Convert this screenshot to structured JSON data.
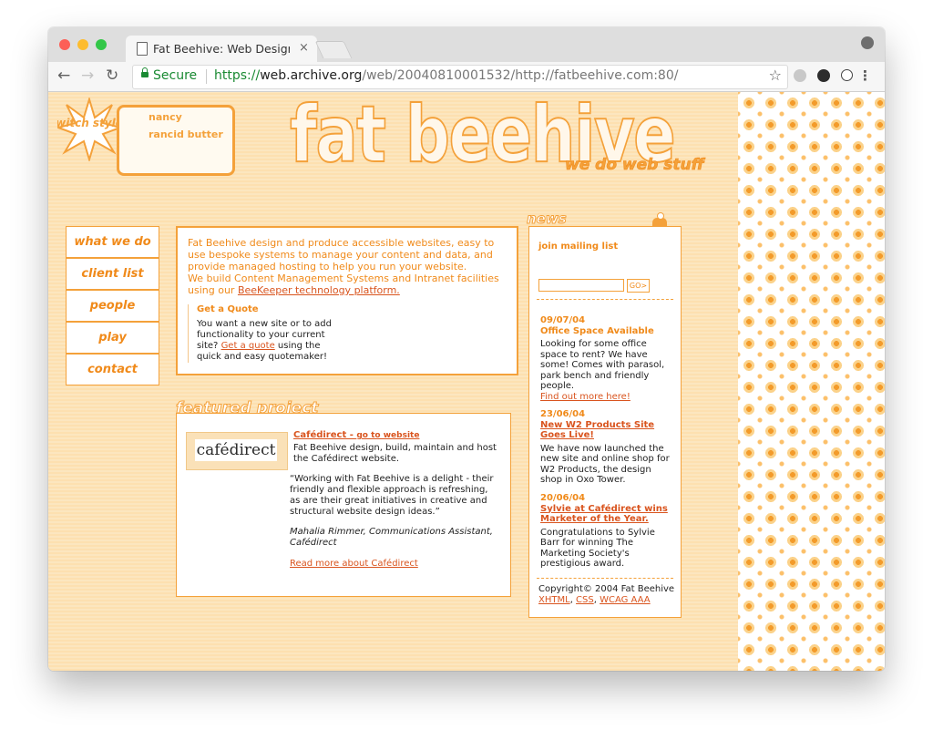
{
  "browser": {
    "tab_title": "Fat Beehive: Web Design - Lon",
    "tab_close": "×",
    "secure_label": "Secure",
    "url_scheme": "https://",
    "url_host": "web.archive.org",
    "url_path": "/web/20040810001532/http://fatbeehive.com:80/",
    "colors": {
      "close": "#fc5f57",
      "minimize": "#fdbc2e",
      "maximize": "#33c748"
    }
  },
  "header": {
    "switch_label": "switch styles",
    "style_options": [
      "nancy",
      "rancid butter"
    ],
    "logo": "fat beehive",
    "tagline": "we do web stuff"
  },
  "nav": {
    "items": [
      {
        "label": "what we do"
      },
      {
        "label": "client list"
      },
      {
        "label": "people"
      },
      {
        "label": "play"
      },
      {
        "label": "contact"
      }
    ]
  },
  "intro": {
    "line1": "Fat Beehive design and produce accessible websites, easy to use bespoke systems to manage your content and data, and provide managed hosting to help you run your website.",
    "line2_prefix": "We build Content Management Systems and Intranet facilities using our ",
    "line2_link": "BeeKeeper technology platform.",
    "quote_title": "Get a Quote",
    "quote_prefix": "You want a new site or to add functionality to your current site? ",
    "quote_link": "Get a quote",
    "quote_suffix": " using the quick and easy quotemaker!"
  },
  "featured": {
    "title": "featured project",
    "logo_text": "cafédirect",
    "project_name": "Cafédirect - ",
    "go_link": "go to website",
    "description": "Fat Beehive design, build, maintain and host the Cafédirect website.",
    "testimonial": "“Working with Fat Beehive is a delight - their friendly and flexible approach is refreshing, as are their great initiatives in creative and structural website design ideas.”",
    "attribution": "Mahalia Rimmer, Communications Assistant, Cafédirect",
    "read_more": "Read more about Cafédirect"
  },
  "news": {
    "title": "news",
    "mailing_label": "join mailing list",
    "go_button": "GO>",
    "items": [
      {
        "date": "09/07/04",
        "headline": "Office Space Available",
        "body": "Looking for some office space to rent? We have some! Comes with parasol, park bench and friendly people.",
        "link": "Find out more here!"
      },
      {
        "date": "23/06/04",
        "headline": "New W2 Products Site Goes Live!",
        "body": "We have now launched the new site and online shop for W2 Products, the design shop in Oxo Tower.",
        "link": ""
      },
      {
        "date": "20/06/04",
        "headline": "Sylvie at Cafédirect wins Marketer of the Year.",
        "body": "Congratulations to Sylvie Barr for winning The Marketing Society's prestigious award.",
        "link": ""
      }
    ],
    "copyright": "Copyright© 2004 Fat Beehive",
    "footer_links": [
      "XHTML",
      "CSS",
      "WCAG AAA"
    ]
  }
}
